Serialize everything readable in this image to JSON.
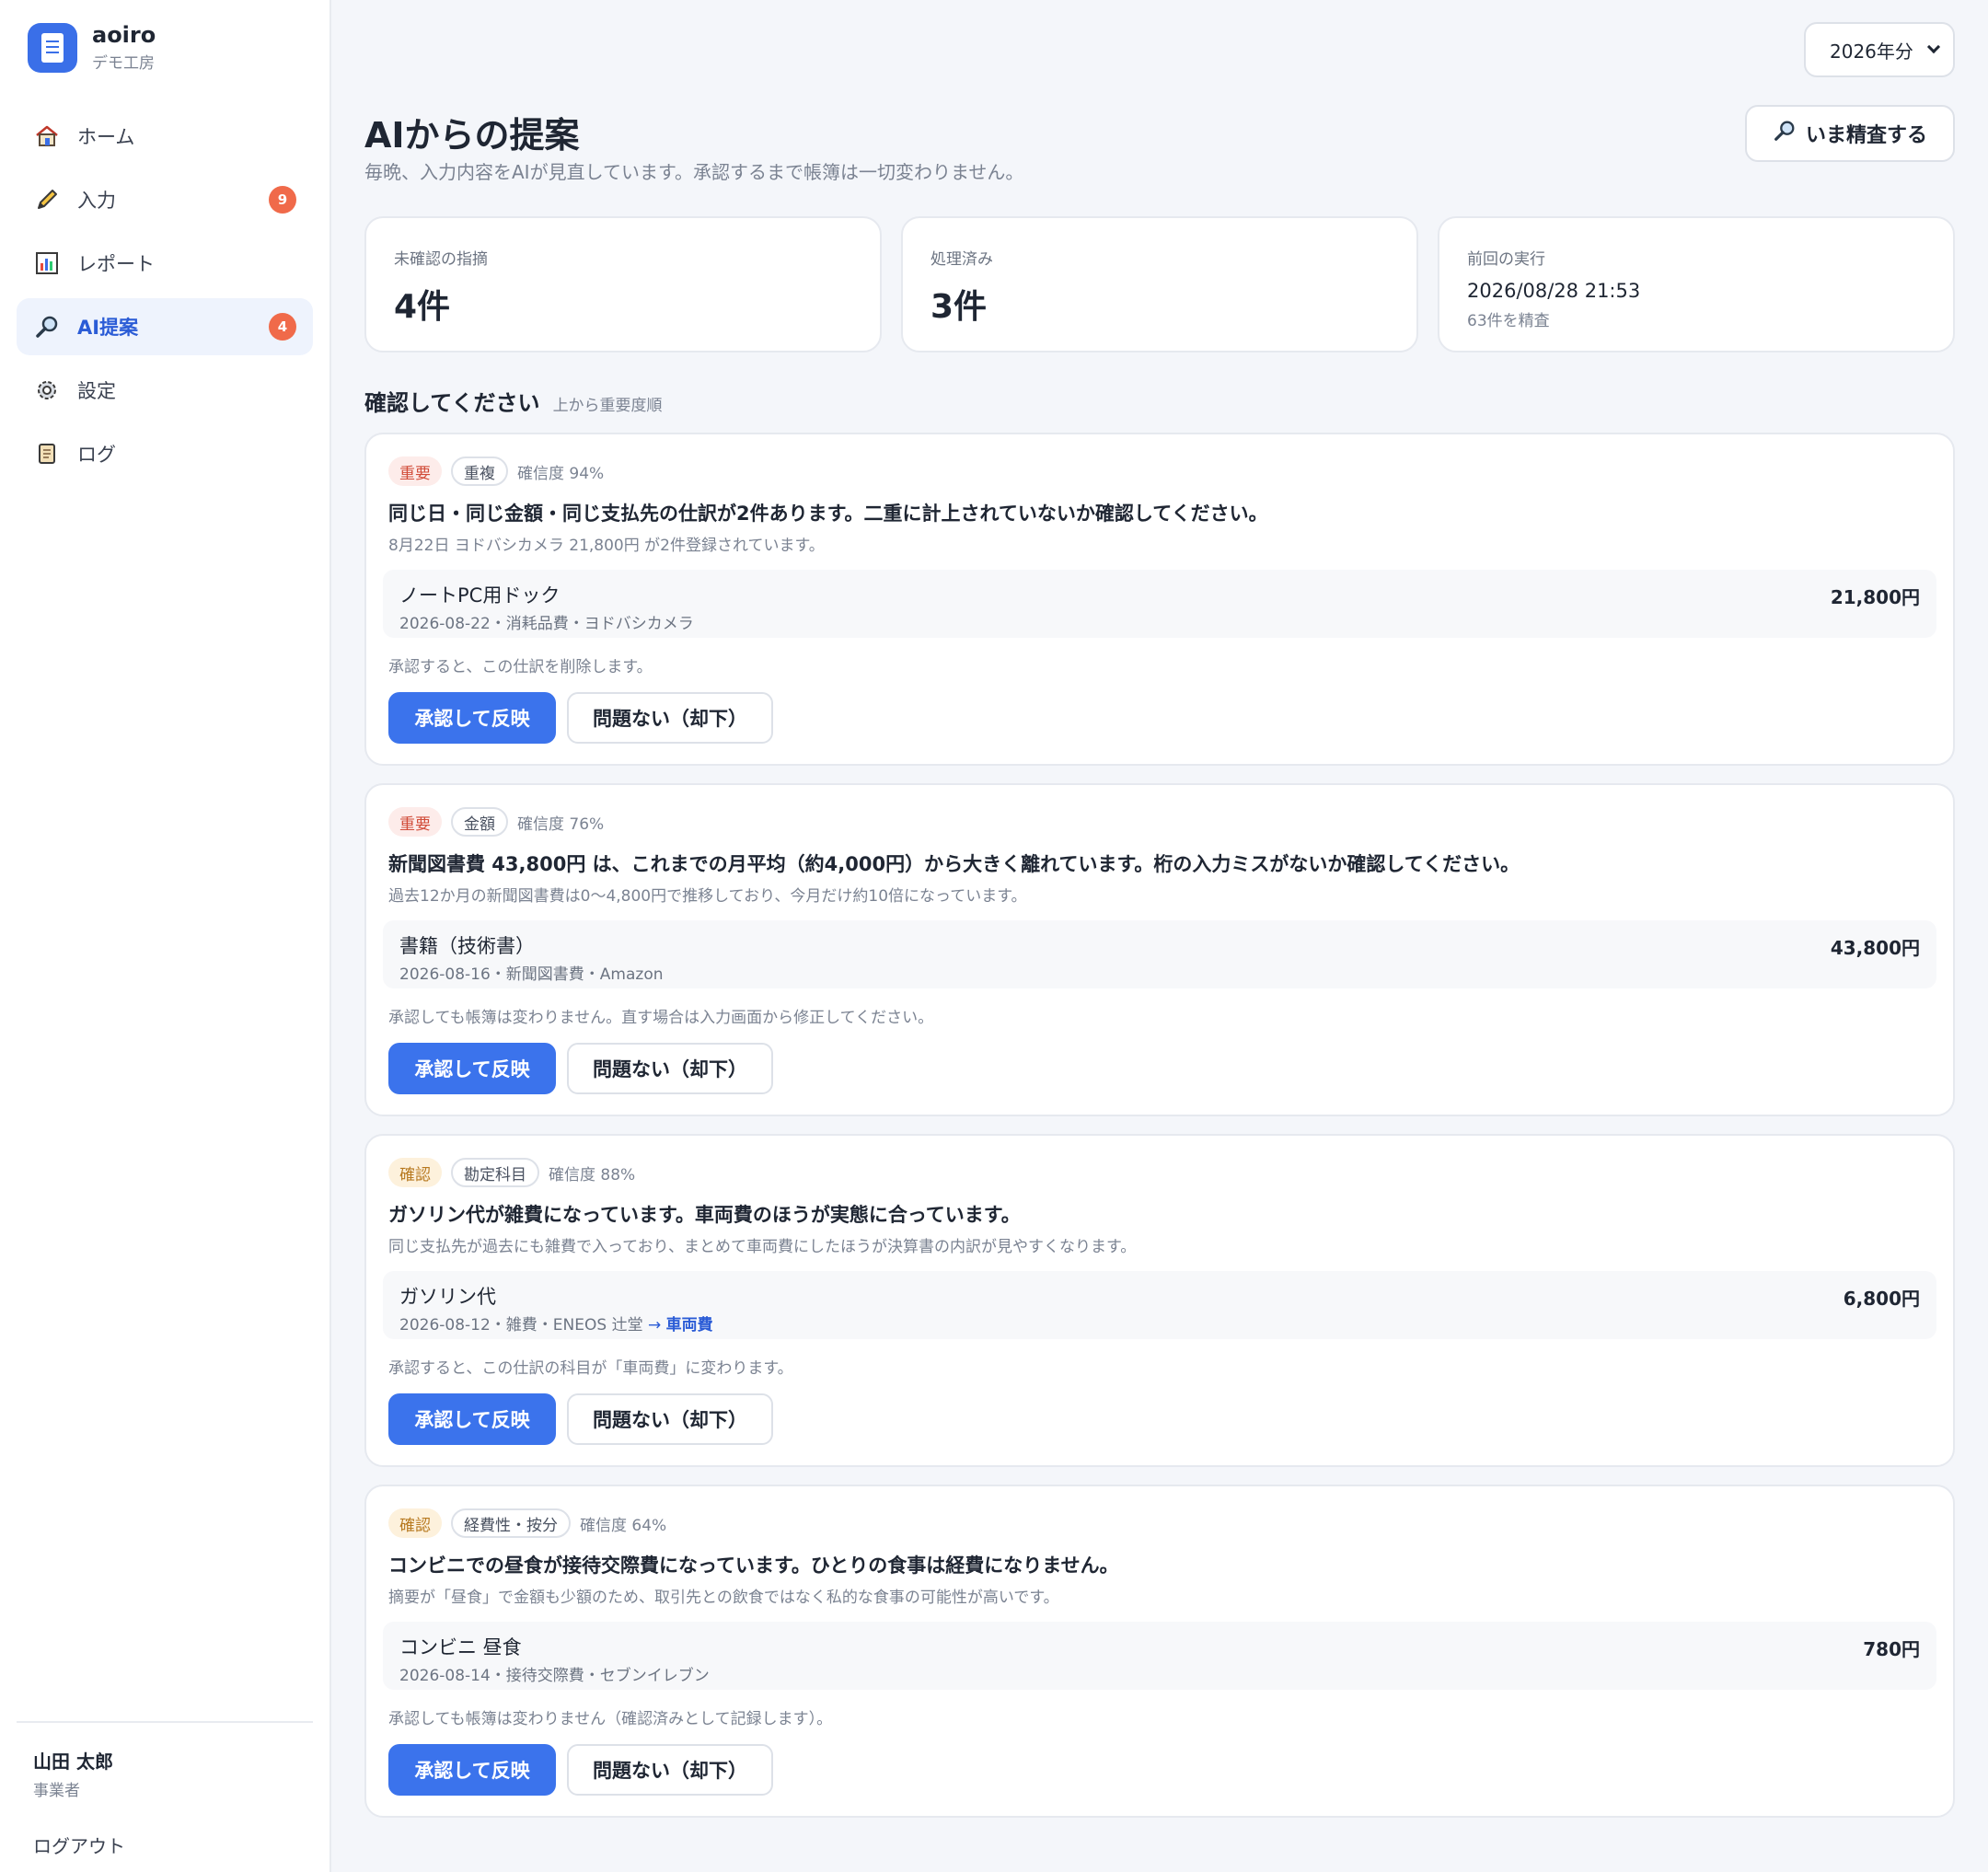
{
  "brand": {
    "name": "aoiro",
    "sub": "デモ工房"
  },
  "nav": [
    {
      "label": "ホーム",
      "icon": "home-icon",
      "badge": ""
    },
    {
      "label": "入力",
      "icon": "pencil-icon",
      "badge": "9"
    },
    {
      "label": "レポート",
      "icon": "chart-icon",
      "badge": ""
    },
    {
      "label": "AI提案",
      "icon": "magnifier-icon",
      "badge": "4",
      "active": true
    },
    {
      "label": "設定",
      "icon": "gear-icon",
      "badge": ""
    },
    {
      "label": "ログ",
      "icon": "scroll-icon",
      "badge": ""
    }
  ],
  "user": {
    "name": "山田 太郎",
    "role": "事業者",
    "logout": "ログアウト"
  },
  "year_select": {
    "value": "2026年分"
  },
  "header": {
    "title": "AIからの提案",
    "subtitle": "毎晩、入力内容をAIが見直しています。承認するまで帳簿は一切変わりません。",
    "run_button": "いま精査する"
  },
  "stats": {
    "pending": {
      "label": "未確認の指摘",
      "value": "4件"
    },
    "done": {
      "label": "処理済み",
      "value": "3件"
    },
    "last_run": {
      "label": "前回の実行",
      "value": "2026/08/28 21:53",
      "note": "63件を精査"
    }
  },
  "section": {
    "title": "確認してください",
    "note": "上から重要度順"
  },
  "buttons": {
    "approve": "承認して反映",
    "dismiss": "問題ない（却下）"
  },
  "suggestions": [
    {
      "severity": "重要",
      "severity_color": "#d14b38",
      "category": "重複",
      "confidence": "確信度 94%",
      "title": "同じ日・同じ金額・同じ支払先の仕訳が2件あります。二重に計上されていないか確認してください。",
      "desc": "8月22日 ヨドバシカメラ 21,800円 が2件登録されています。",
      "entry": {
        "name": "ノートPC用ドック",
        "meta": "2026-08-22・消耗品費・ヨドバシカメラ",
        "amount": "21,800円"
      },
      "effect": "承認すると、この仕訳を削除します。"
    },
    {
      "severity": "重要",
      "severity_color": "#d14b38",
      "category": "金額",
      "confidence": "確信度 76%",
      "title": "新聞図書費 43,800円 は、これまでの月平均（約4,000円）から大きく離れています。桁の入力ミスがないか確認してください。",
      "desc": "過去12か月の新聞図書費は0〜4,800円で推移しており、今月だけ約10倍になっています。",
      "entry": {
        "name": "書籍（技術書）",
        "meta": "2026-08-16・新聞図書費・Amazon",
        "amount": "43,800円"
      },
      "effect": "承認しても帳簿は変わりません。直す場合は入力画面から修正してください。"
    },
    {
      "severity": "確認",
      "severity_color": "#b7791f",
      "category": "勘定科目",
      "confidence": "確信度 88%",
      "title": "ガソリン代が雑費になっています。車両費のほうが実態に合っています。",
      "desc": "同じ支払先が過去にも雑費で入っており、まとめて車両費にしたほうが決算書の内訳が見やすくなります。",
      "entry": {
        "name": "ガソリン代",
        "meta": "2026-08-12・雑費・ENEOS 辻堂",
        "arrow": "→",
        "new_account": "車両費",
        "amount": "6,800円"
      },
      "effect": "承認すると、この仕訳の科目が「車両費」に変わります。"
    },
    {
      "severity": "確認",
      "severity_color": "#b7791f",
      "category": "経費性・按分",
      "confidence": "確信度 64%",
      "title": "コンビニでの昼食が接待交際費になっています。ひとりの食事は経費になりません。",
      "desc": "摘要が「昼食」で金額も少額のため、取引先との飲食ではなく私的な食事の可能性が高いです。",
      "entry": {
        "name": "コンビニ 昼食",
        "meta": "2026-08-14・接待交際費・セブンイレブン",
        "amount": "780円"
      },
      "effect": "承認しても帳簿は変わりません（確認済みとして記録します）。"
    }
  ]
}
